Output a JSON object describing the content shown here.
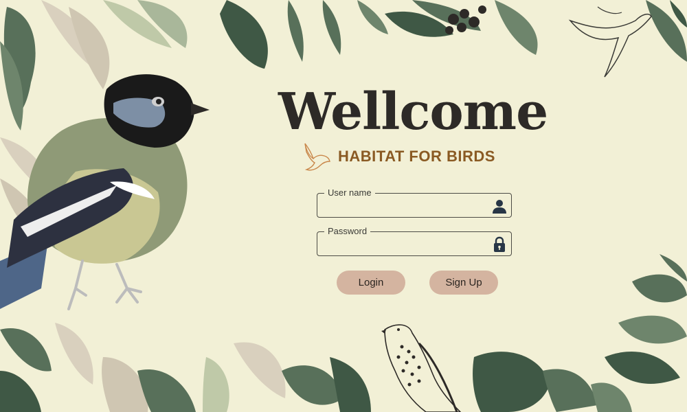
{
  "header": {
    "title": "Wellcome",
    "subtitle": "HABITAT FOR BIRDS"
  },
  "form": {
    "username": {
      "label": "User name",
      "value": "",
      "placeholder": ""
    },
    "password": {
      "label": "Password",
      "value": "",
      "placeholder": ""
    }
  },
  "buttons": {
    "login": "Login",
    "signup": "Sign Up"
  },
  "icons": {
    "username": "person-icon",
    "password": "lock-icon",
    "logo": "dove-icon"
  },
  "colors": {
    "background": "#f2f0d6",
    "title": "#2d2a27",
    "subtitle": "#8a5a23",
    "button": "#d4b4a0",
    "leaf_dark": "#58705a",
    "leaf_light": "#bfc9a8",
    "leaf_beige": "#d9d0be"
  }
}
